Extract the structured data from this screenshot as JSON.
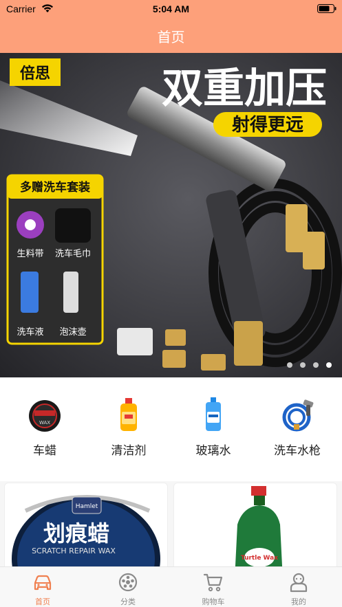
{
  "status_bar": {
    "carrier": "Carrier",
    "time": "5:04 AM"
  },
  "nav": {
    "title": "首页"
  },
  "banner": {
    "brand": "倍思",
    "headline": "双重加压",
    "subheadline": "射得更远",
    "gift_title": "多赠洗车套装",
    "gift_items": [
      "生料带",
      "洗车毛巾",
      "洗车液",
      "泡沫壶"
    ],
    "page_count": 4,
    "active_page": 4
  },
  "categories": [
    {
      "label": "车蜡",
      "icon": "car-wax-icon"
    },
    {
      "label": "清洁剂",
      "icon": "cleaner-bottle-icon"
    },
    {
      "label": "玻璃水",
      "icon": "washer-fluid-icon"
    },
    {
      "label": "洗车水枪",
      "icon": "hose-gun-icon"
    }
  ],
  "products": [
    {
      "brand": "Hamlet",
      "name": "划痕蜡",
      "subtitle": "SCRATCH REPAIR WAX"
    },
    {
      "brand": "Turtle Wax"
    }
  ],
  "tabbar": {
    "items": [
      {
        "label": "首页",
        "active": true
      },
      {
        "label": "分类",
        "active": false
      },
      {
        "label": "购物车",
        "active": false
      },
      {
        "label": "我的",
        "active": false
      }
    ]
  },
  "colors": {
    "header": "#fda07a",
    "accent": "#f08050",
    "inactive": "#8a8a8a"
  }
}
